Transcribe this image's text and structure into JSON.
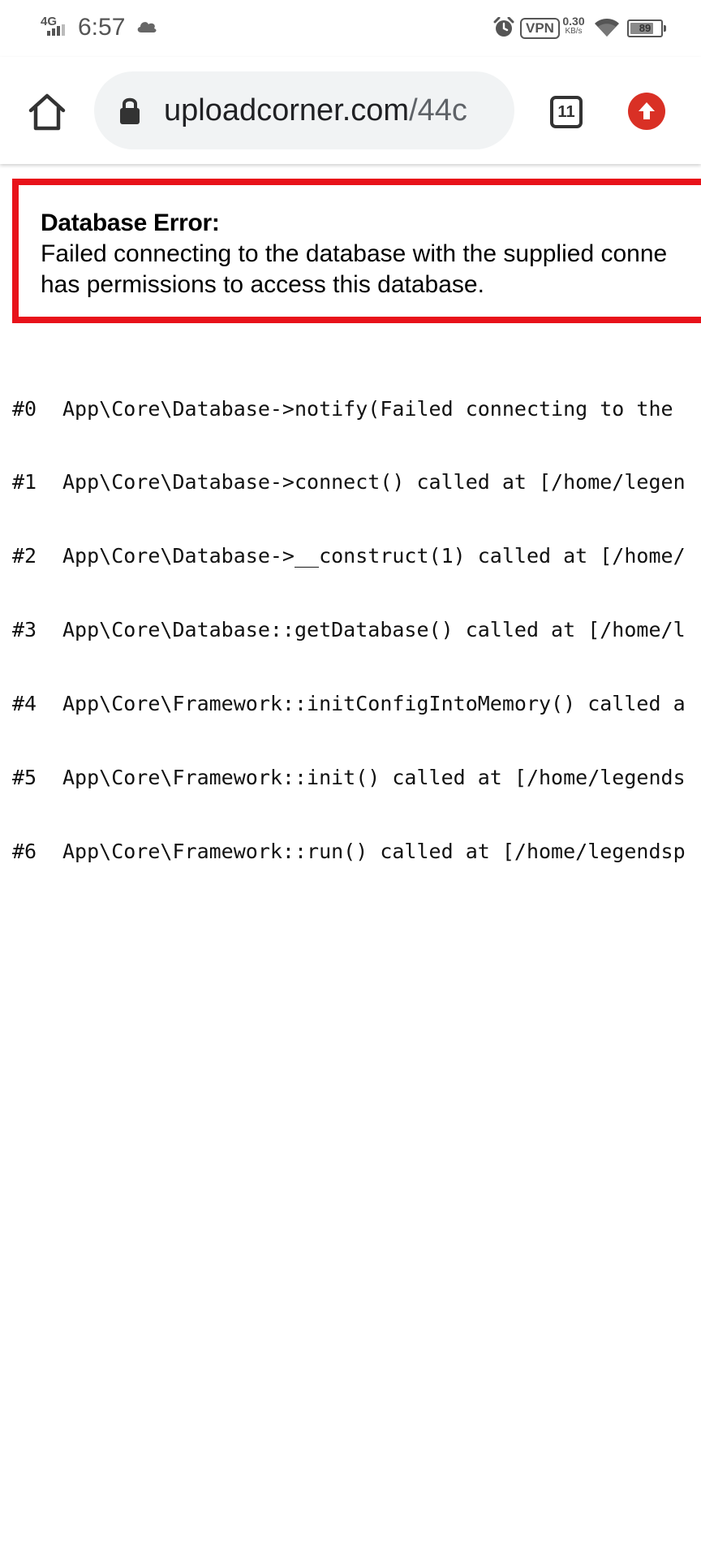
{
  "status_bar": {
    "network": "4G",
    "time": "6:57",
    "vpn": "VPN",
    "speed_value": "0.30",
    "speed_unit": "KB/s",
    "battery": "89",
    "battery_level": 0.89,
    "icons": [
      "signal-icon",
      "cloud-icon",
      "alarm-icon",
      "wifi-icon",
      "battery-icon"
    ]
  },
  "browser": {
    "url_domain": "uploadcorner.com",
    "url_path": "/44c",
    "tab_count": "11",
    "icons": [
      "home-icon",
      "lock-icon",
      "tabs-icon",
      "upload-icon"
    ],
    "upload_color": "#d93025"
  },
  "error": {
    "title": "Database Error:",
    "message_line1": "Failed connecting to the database with the supplied conne",
    "message_line2": "has permissions to access this database.",
    "border_color": "#e8121a"
  },
  "stack_trace": [
    {
      "num": "#0",
      "text": "App\\Core\\Database->notify(Failed connecting to the"
    },
    {
      "num": "#1",
      "text": "App\\Core\\Database->connect() called at [/home/legen"
    },
    {
      "num": "#2",
      "text": "App\\Core\\Database->__construct(1) called at [/home/"
    },
    {
      "num": "#3",
      "text": "App\\Core\\Database::getDatabase() called at [/home/l"
    },
    {
      "num": "#4",
      "text": "App\\Core\\Framework::initConfigIntoMemory() called a"
    },
    {
      "num": "#5",
      "text": "App\\Core\\Framework::init() called at [/home/legends"
    },
    {
      "num": "#6",
      "text": "App\\Core\\Framework::run() called at [/home/legendsp"
    }
  ]
}
